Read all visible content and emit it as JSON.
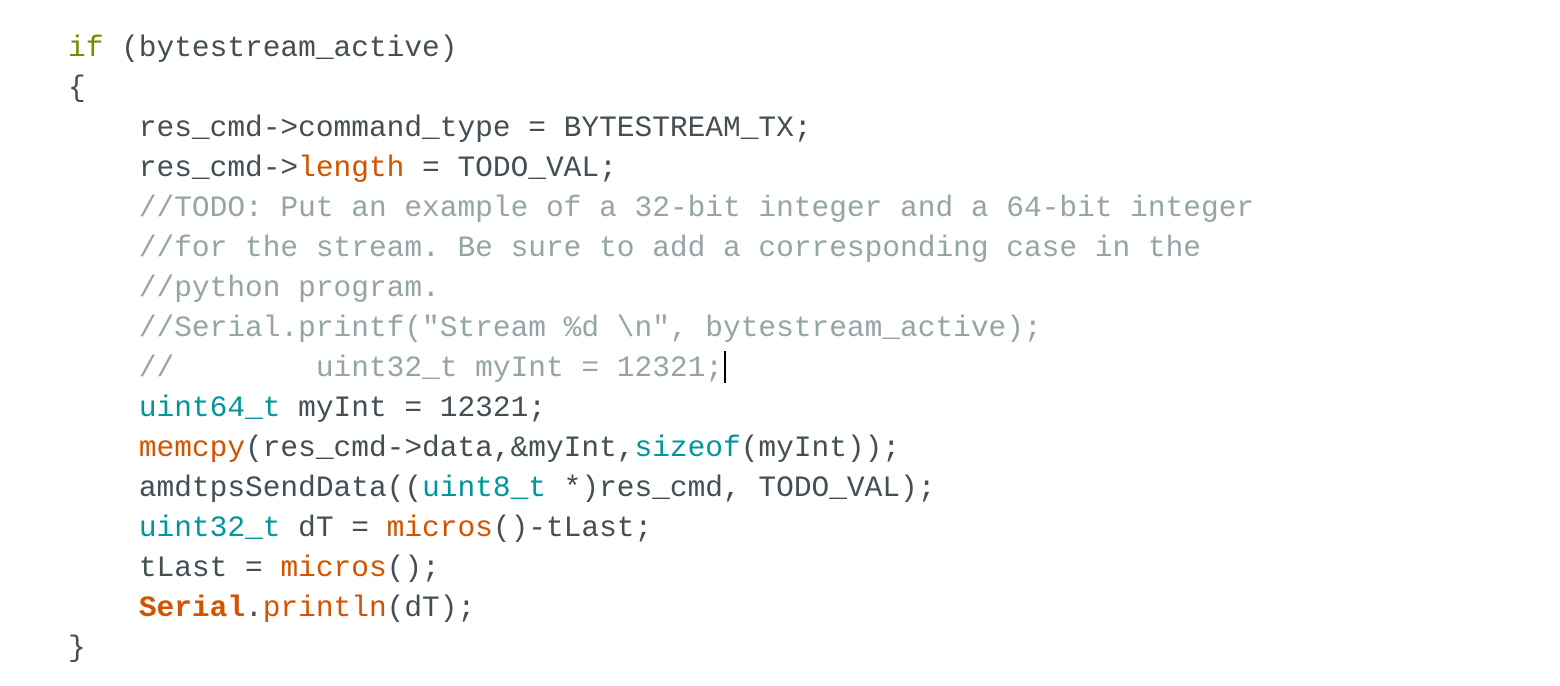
{
  "editor": {
    "caret_line": 8,
    "lines": [
      {
        "indent": "",
        "tokens": [
          {
            "t": "if",
            "c": "kw"
          },
          {
            "t": " (bytestream_active)",
            "c": "plain"
          }
        ]
      },
      {
        "indent": "",
        "tokens": [
          {
            "t": "{",
            "c": "plain"
          }
        ]
      },
      {
        "indent": "    ",
        "tokens": [
          {
            "t": "res_cmd->command_type = BYTESTREAM_TX;",
            "c": "plain"
          }
        ]
      },
      {
        "indent": "    ",
        "tokens": [
          {
            "t": "res_cmd->",
            "c": "plain"
          },
          {
            "t": "length",
            "c": "fn"
          },
          {
            "t": " = TODO_VAL;",
            "c": "plain"
          }
        ]
      },
      {
        "indent": "    ",
        "tokens": [
          {
            "t": "//TODO: Put an example of a 32-bit integer and a 64-bit integer",
            "c": "comment"
          }
        ]
      },
      {
        "indent": "    ",
        "tokens": [
          {
            "t": "//for the stream. Be sure to add a corresponding case in the",
            "c": "comment"
          }
        ]
      },
      {
        "indent": "    ",
        "tokens": [
          {
            "t": "//python program.",
            "c": "comment"
          }
        ]
      },
      {
        "indent": "    ",
        "tokens": [
          {
            "t": "//Serial.printf(\"Stream %d \\n\", bytestream_active);",
            "c": "comment"
          }
        ]
      },
      {
        "indent": "    ",
        "tokens": [
          {
            "t": "//        uint32_t myInt = 12321;",
            "c": "comment"
          }
        ]
      },
      {
        "indent": "    ",
        "tokens": [
          {
            "t": "uint64_t",
            "c": "type"
          },
          {
            "t": " myInt = 12321;",
            "c": "plain"
          }
        ]
      },
      {
        "indent": "    ",
        "tokens": [
          {
            "t": "memcpy",
            "c": "fn"
          },
          {
            "t": "(res_cmd->data,&myInt,",
            "c": "plain"
          },
          {
            "t": "sizeof",
            "c": "type"
          },
          {
            "t": "(myInt));",
            "c": "plain"
          }
        ]
      },
      {
        "indent": "    ",
        "tokens": [
          {
            "t": "amdtpsSendData((",
            "c": "plain"
          },
          {
            "t": "uint8_t",
            "c": "type"
          },
          {
            "t": " *)res_cmd, TODO_VAL);",
            "c": "plain"
          }
        ]
      },
      {
        "indent": "    ",
        "tokens": [
          {
            "t": "uint32_t",
            "c": "type"
          },
          {
            "t": " dT = ",
            "c": "plain"
          },
          {
            "t": "micros",
            "c": "fn"
          },
          {
            "t": "()-tLast;",
            "c": "plain"
          }
        ]
      },
      {
        "indent": "    ",
        "tokens": [
          {
            "t": "tLast = ",
            "c": "plain"
          },
          {
            "t": "micros",
            "c": "fn"
          },
          {
            "t": "();",
            "c": "plain"
          }
        ]
      },
      {
        "indent": "    ",
        "tokens": [
          {
            "t": "Serial",
            "c": "class"
          },
          {
            "t": ".",
            "c": "plain"
          },
          {
            "t": "println",
            "c": "fn"
          },
          {
            "t": "(dT);",
            "c": "plain"
          }
        ]
      },
      {
        "indent": "",
        "tokens": [
          {
            "t": "}",
            "c": "plain"
          }
        ]
      }
    ]
  }
}
